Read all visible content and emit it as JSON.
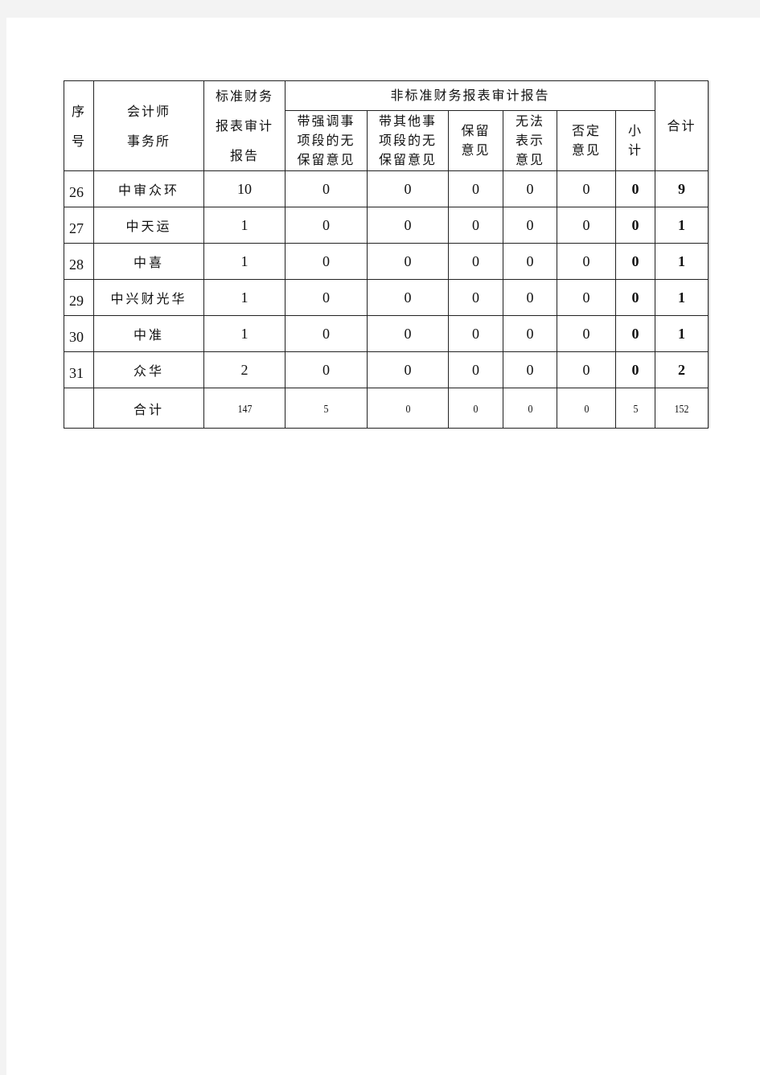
{
  "table": {
    "headers": {
      "seq": "序\n号",
      "seq_lines": [
        "序",
        "号"
      ],
      "firm_lines": [
        "会计师",
        "事务所"
      ],
      "standard_lines": [
        "标准财务",
        "报表审计",
        "报告"
      ],
      "nonstandard": "非标准财务报表审计报告",
      "emphasis_lines": [
        "带强调事",
        "项段的无",
        "保留意见"
      ],
      "other_lines": [
        "带其他事",
        "项段的无",
        "保留意见"
      ],
      "qualified_lines": [
        "保留",
        "意见"
      ],
      "disclaimer_lines": [
        "无法",
        "表示",
        "意见"
      ],
      "adverse_lines": [
        "否定",
        "意见"
      ],
      "subtotal_lines": [
        "小",
        "计"
      ],
      "total": "合计"
    },
    "rows": [
      {
        "seq": "26",
        "firm": "中审众环",
        "standard": "10",
        "emphasis": "0",
        "other": "0",
        "qualified": "0",
        "disclaimer": "0",
        "adverse": "0",
        "subtotal": "0",
        "total": "9"
      },
      {
        "seq": "27",
        "firm": "中天运",
        "standard": "1",
        "emphasis": "0",
        "other": "0",
        "qualified": "0",
        "disclaimer": "0",
        "adverse": "0",
        "subtotal": "0",
        "total": "1"
      },
      {
        "seq": "28",
        "firm": "中喜",
        "standard": "1",
        "emphasis": "0",
        "other": "0",
        "qualified": "0",
        "disclaimer": "0",
        "adverse": "0",
        "subtotal": "0",
        "total": "1"
      },
      {
        "seq": "29",
        "firm": "中兴财光华",
        "standard": "1",
        "emphasis": "0",
        "other": "0",
        "qualified": "0",
        "disclaimer": "0",
        "adverse": "0",
        "subtotal": "0",
        "total": "1"
      },
      {
        "seq": "30",
        "firm": "中准",
        "standard": "1",
        "emphasis": "0",
        "other": "0",
        "qualified": "0",
        "disclaimer": "0",
        "adverse": "0",
        "subtotal": "0",
        "total": "1"
      },
      {
        "seq": "31",
        "firm": "众华",
        "standard": "2",
        "emphasis": "0",
        "other": "0",
        "qualified": "0",
        "disclaimer": "0",
        "adverse": "0",
        "subtotal": "0",
        "total": "2"
      }
    ],
    "totals": {
      "seq": "",
      "label": "合计",
      "standard": "147",
      "emphasis": "5",
      "other": "0",
      "qualified": "0",
      "disclaimer": "0",
      "adverse": "0",
      "subtotal": "5",
      "total": "152"
    }
  }
}
